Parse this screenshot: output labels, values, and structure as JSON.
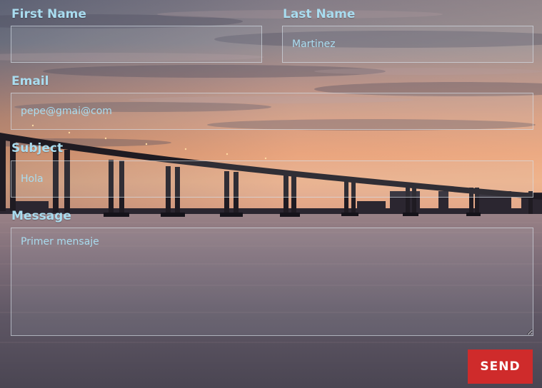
{
  "form": {
    "first_name": {
      "label": "First Name",
      "value": ""
    },
    "last_name": {
      "label": "Last Name",
      "value": "Martinez"
    },
    "email": {
      "label": "Email",
      "value": "pepe@gmai@com"
    },
    "subject": {
      "label": "Subject",
      "value": "Hola"
    },
    "message": {
      "label": "Message",
      "value": "Primer mensaje"
    },
    "send_label": "SEND"
  },
  "colors": {
    "label": "#a9dcef",
    "button": "#cf2b2b",
    "button_text": "#ffffff"
  }
}
